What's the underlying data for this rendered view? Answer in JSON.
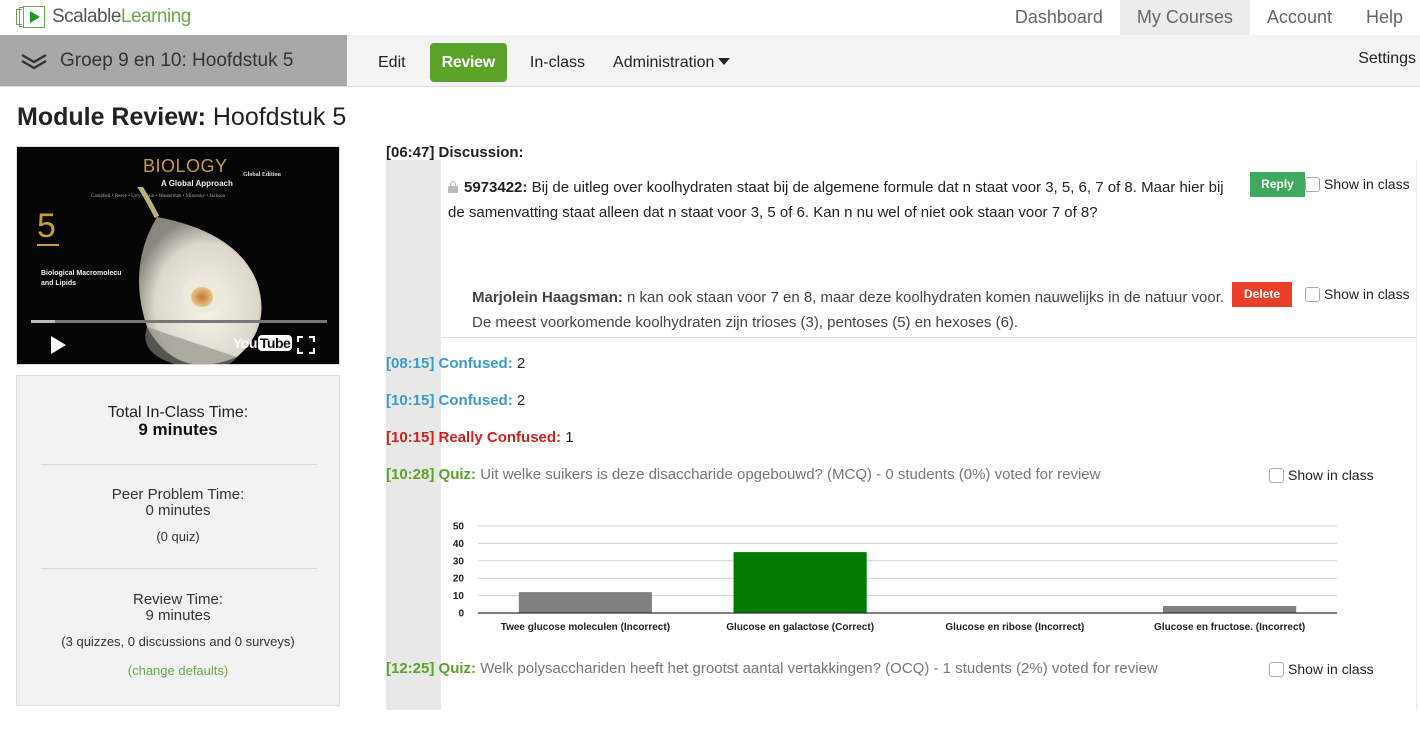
{
  "brand": {
    "name_part1": "Scalable",
    "name_part2": "Learning"
  },
  "topnav": [
    {
      "label": "Dashboard",
      "active": false
    },
    {
      "label": "My Courses",
      "active": true
    },
    {
      "label": "Account",
      "active": false
    },
    {
      "label": "Help",
      "active": false
    }
  ],
  "course": {
    "title": "Groep 9 en 10: Hoofdstuk 5"
  },
  "subnav": {
    "edit": "Edit",
    "review": "Review",
    "inclass": "In-class",
    "administration": "Administration",
    "settings": "Settings"
  },
  "page": {
    "title_bold": "Module Review:",
    "title_rest": " Hoofdstuk 5"
  },
  "video": {
    "book_title": "BIOLOGY",
    "book_subtitle": "A Global Approach",
    "edition": "Global Edition",
    "authors": "Campbell • Reece • Urry • Cain • Wasserman • Minorsky • Jackson",
    "chapter_number": "5",
    "chapter_title_1": "Biological Macromolecu",
    "chapter_title_2": "and Lipids",
    "progress_fraction": 0.08,
    "youtube_label_1": "You",
    "youtube_label_2": "Tube"
  },
  "stats": {
    "total_label": "Total In-Class Time:",
    "total_value": "9 minutes",
    "peer_label": "Peer Problem Time:",
    "peer_value": "0 minutes",
    "peer_detail": "(0 quiz)",
    "review_label": "Review Time:",
    "review_value": "9 minutes",
    "review_detail": "(3 quizzes, 0 discussions and 0 surveys)",
    "change_defaults": "(change defaults)"
  },
  "timeline": {
    "show_in_class": "Show in class",
    "discussion": {
      "time": "[06:47]",
      "kind": "Discussion:",
      "author": "5973422:",
      "text": " Bij de uitleg over koolhydraten staat bij de algemene formule dat n staat voor 3, 5, 6, 7 of 8. Maar hier bij de samenvatting staat alleen dat n staat voor 3, 5 of 6. Kan n nu wel of niet ook staan voor 7 of 8?",
      "reply_button": "Reply",
      "reply_author": "Marjolein Haagsman:",
      "reply_text": " n kan ook staan voor 7 en 8, maar deze koolhydraten komen nauwelijks in de natuur voor. De meest voorkomende koolhydraten zijn trioses (3), pentoses (5) en hexoses (6).",
      "delete_button": "Delete"
    },
    "markers": [
      {
        "time": "[08:15]",
        "kind": "Confused:",
        "count": "2"
      },
      {
        "time": "[10:15]",
        "kind": "Confused:",
        "count": "2"
      },
      {
        "time": "[10:15]",
        "kind": "Really Confused:",
        "count": "1"
      }
    ],
    "quizzes": [
      {
        "time": "[10:28]",
        "kind": "Quiz:",
        "text": " Uit welke suikers is deze disaccharide opgebouwd? (MCQ) - 0 students (0%) voted for review"
      },
      {
        "time": "[12:25]",
        "kind": "Quiz:",
        "text": " Welk polysacchariden heeft het grootst aantal vertakkingen? (OCQ) - 1 students (2%) voted for review"
      }
    ]
  },
  "colors": {
    "brand_green": "#6aa84f",
    "review_green": "#5aa22a",
    "confused_blue": "#3a9bc8",
    "really_confused_red": "#c8231e",
    "reply_green": "#3daa5f",
    "delete_red": "#e8402a",
    "correct_bar": "#007a00",
    "incorrect_bar": "#808080"
  },
  "chart_data": {
    "type": "bar",
    "title": "",
    "xlabel": "",
    "ylabel": "",
    "categories": [
      "Twee glucose moleculen (Incorrect)",
      "Glucose en galactose (Correct)",
      "Glucose en ribose (Incorrect)",
      "Glucose en fructose. (Incorrect)"
    ],
    "values": [
      12,
      35,
      0,
      4
    ],
    "correct": [
      false,
      true,
      false,
      false
    ],
    "ylim": [
      0,
      50
    ],
    "yticks": [
      0,
      10,
      20,
      30,
      40,
      50
    ],
    "grid": true,
    "legend": "none"
  }
}
